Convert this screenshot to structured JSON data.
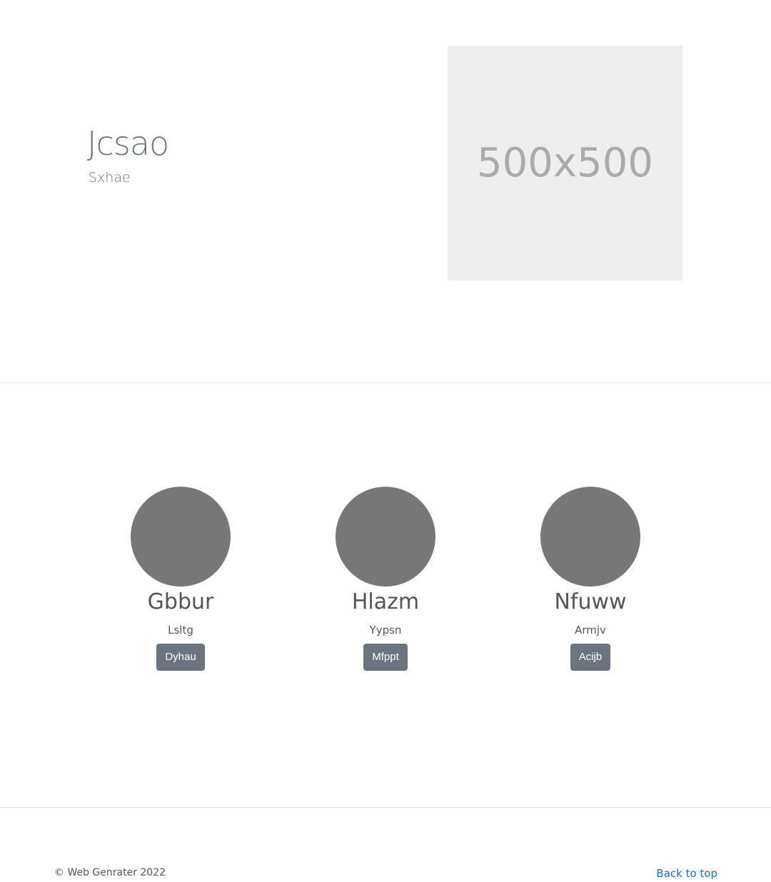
{
  "hero": {
    "title": "Jcsao",
    "subtitle": "Sxhae",
    "image_placeholder": "500x500"
  },
  "team": [
    {
      "name": "Gbbur",
      "role": "Lsltg",
      "button": "Dyhau"
    },
    {
      "name": "Hlazm",
      "role": "Yypsn",
      "button": "Mfppt"
    },
    {
      "name": "Nfuww",
      "role": "Armjv",
      "button": "Acijb"
    }
  ],
  "footer": {
    "copyright": "© Web Genrater 2022",
    "back_to_top": "Back to top"
  }
}
